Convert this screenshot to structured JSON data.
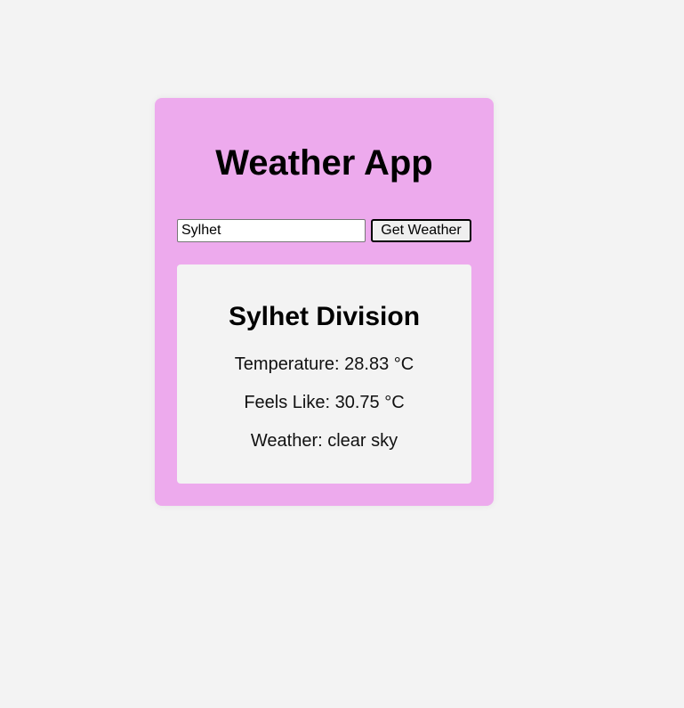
{
  "app": {
    "title": "Weather App"
  },
  "search": {
    "value": "Sylhet",
    "button_label": "Get Weather"
  },
  "result": {
    "location": "Sylhet Division",
    "temperature_text": "Temperature: 28.83 °C",
    "feels_like_text": "Feels Like: 30.75 °C",
    "weather_text": "Weather: clear sky"
  },
  "colors": {
    "page_background": "#f3f3f3",
    "card_background": "#edaaed",
    "result_background": "#f3f3f3"
  }
}
